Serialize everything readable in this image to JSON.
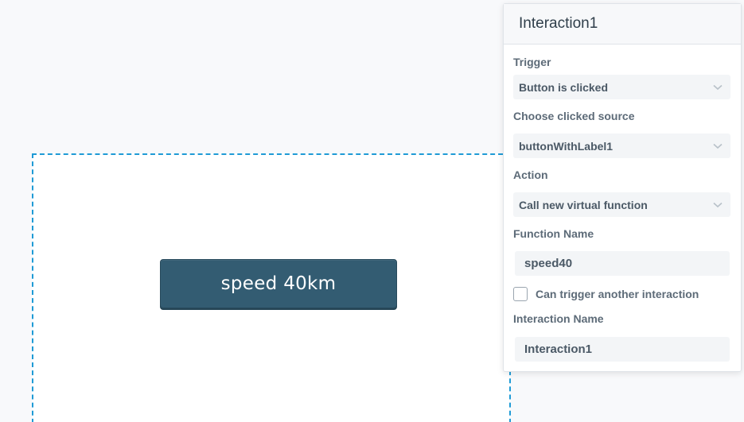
{
  "canvas": {
    "button_label": "speed 40km"
  },
  "panel": {
    "title": "Interaction1",
    "trigger": {
      "label": "Trigger",
      "value": "Button is clicked"
    },
    "source": {
      "label": "Choose clicked source",
      "value": "buttonWithLabel1"
    },
    "action": {
      "label": "Action",
      "value": "Call new virtual function"
    },
    "function_name": {
      "label": "Function Name",
      "value": "speed40"
    },
    "can_trigger": {
      "label": "Can trigger another interaction",
      "checked": false
    },
    "interaction_name": {
      "label": "Interaction Name",
      "value": "Interaction1"
    }
  },
  "icons": {
    "select_arrow": "chevron-down-icon"
  },
  "colors": {
    "selection_border": "#1f9bd6",
    "button_bg": "#335c72"
  }
}
